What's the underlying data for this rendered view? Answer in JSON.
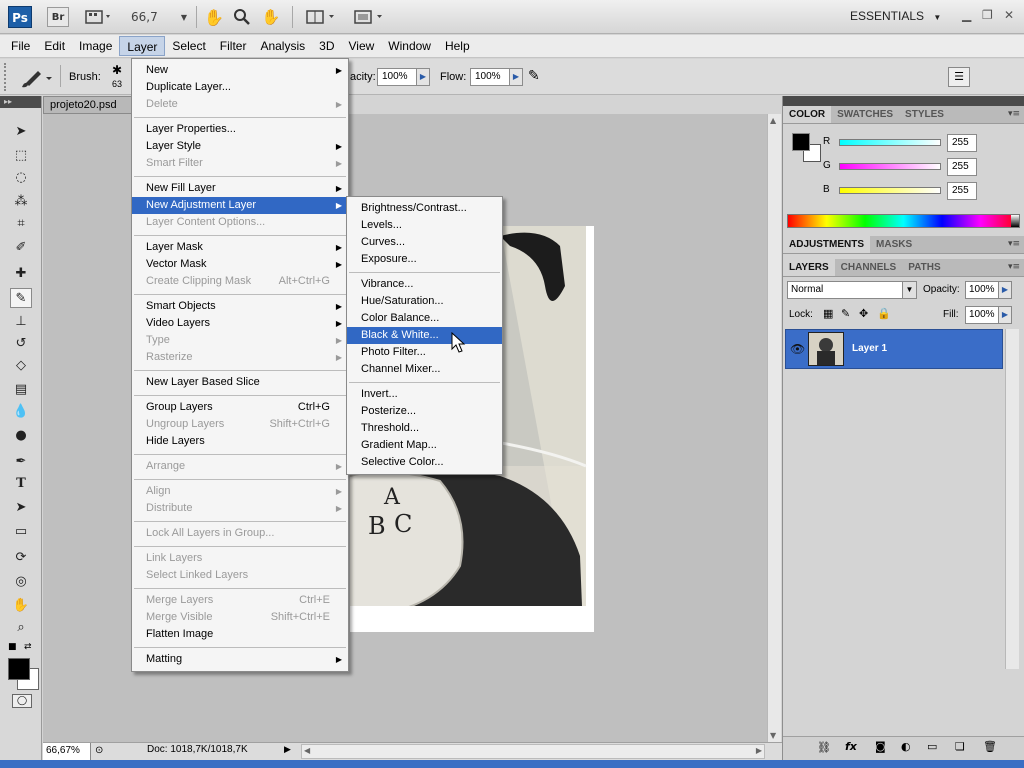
{
  "app": {
    "logo": "Ps",
    "bridge": "Br",
    "zoom": "66,7",
    "workspace": "ESSENTIALS"
  },
  "menubar": [
    "File",
    "Edit",
    "Image",
    "Layer",
    "Select",
    "Filter",
    "Analysis",
    "3D",
    "View",
    "Window",
    "Help"
  ],
  "options": {
    "brush_label": "Brush:",
    "brush_size": "63",
    "opacity_label": "acity:",
    "opacity_value": "100%",
    "flow_label": "Flow:",
    "flow_value": "100%"
  },
  "document": {
    "tab": "projeto20.psd",
    "photo_letters": [
      "A",
      "B",
      "C"
    ]
  },
  "status": {
    "zoom": "66,67%",
    "doc": "Doc: 1018,7K/1018,7K"
  },
  "layer_menu": [
    {
      "label": "New",
      "sub": true
    },
    {
      "label": "Duplicate Layer..."
    },
    {
      "label": "Delete",
      "disabled": true,
      "sub": true
    },
    {
      "sep": true
    },
    {
      "label": "Layer Properties..."
    },
    {
      "label": "Layer Style",
      "sub": true
    },
    {
      "label": "Smart Filter",
      "disabled": true,
      "sub": true
    },
    {
      "sep": true
    },
    {
      "label": "New Fill Layer",
      "sub": true
    },
    {
      "label": "New Adjustment Layer",
      "sub": true,
      "highlight": true
    },
    {
      "label": "Layer Content Options...",
      "disabled": true
    },
    {
      "sep": true
    },
    {
      "label": "Layer Mask",
      "sub": true
    },
    {
      "label": "Vector Mask",
      "sub": true
    },
    {
      "label": "Create Clipping Mask",
      "disabled": true,
      "shortcut": "Alt+Ctrl+G"
    },
    {
      "sep": true
    },
    {
      "label": "Smart Objects",
      "sub": true
    },
    {
      "label": "Video Layers",
      "sub": true
    },
    {
      "label": "Type",
      "disabled": true,
      "sub": true
    },
    {
      "label": "Rasterize",
      "disabled": true,
      "sub": true
    },
    {
      "sep": true
    },
    {
      "label": "New Layer Based Slice"
    },
    {
      "sep": true
    },
    {
      "label": "Group Layers",
      "shortcut": "Ctrl+G"
    },
    {
      "label": "Ungroup Layers",
      "disabled": true,
      "shortcut": "Shift+Ctrl+G"
    },
    {
      "label": "Hide Layers"
    },
    {
      "sep": true
    },
    {
      "label": "Arrange",
      "disabled": true,
      "sub": true
    },
    {
      "sep": true
    },
    {
      "label": "Align",
      "disabled": true,
      "sub": true
    },
    {
      "label": "Distribute",
      "disabled": true,
      "sub": true
    },
    {
      "sep": true
    },
    {
      "label": "Lock All Layers in Group...",
      "disabled": true
    },
    {
      "sep": true
    },
    {
      "label": "Link Layers",
      "disabled": true
    },
    {
      "label": "Select Linked Layers",
      "disabled": true
    },
    {
      "sep": true
    },
    {
      "label": "Merge Layers",
      "disabled": true,
      "shortcut": "Ctrl+E"
    },
    {
      "label": "Merge Visible",
      "disabled": true,
      "shortcut": "Shift+Ctrl+E"
    },
    {
      "label": "Flatten Image"
    },
    {
      "sep": true
    },
    {
      "label": "Matting",
      "sub": true
    }
  ],
  "adjustment_menu": [
    {
      "label": "Brightness/Contrast..."
    },
    {
      "label": "Levels..."
    },
    {
      "label": "Curves..."
    },
    {
      "label": "Exposure..."
    },
    {
      "sep": true
    },
    {
      "label": "Vibrance..."
    },
    {
      "label": "Hue/Saturation..."
    },
    {
      "label": "Color Balance..."
    },
    {
      "label": "Black & White...",
      "highlight": true
    },
    {
      "label": "Photo Filter..."
    },
    {
      "label": "Channel Mixer..."
    },
    {
      "sep": true
    },
    {
      "label": "Invert..."
    },
    {
      "label": "Posterize..."
    },
    {
      "label": "Threshold..."
    },
    {
      "label": "Gradient Map..."
    },
    {
      "label": "Selective Color..."
    }
  ],
  "color_panel": {
    "tabs": [
      "COLOR",
      "SWATCHES",
      "STYLES"
    ],
    "channels": [
      {
        "name": "R",
        "value": "255",
        "color": "#00e5e5"
      },
      {
        "name": "G",
        "value": "255",
        "color": "#e500e5"
      },
      {
        "name": "B",
        "value": "255",
        "color": "#e5e500"
      }
    ]
  },
  "adjust_panel": {
    "tabs": [
      "ADJUSTMENTS",
      "MASKS"
    ]
  },
  "layers_panel": {
    "tabs": [
      "LAYERS",
      "CHANNELS",
      "PATHS"
    ],
    "blend_mode": "Normal",
    "opacity_label": "Opacity:",
    "opacity": "100%",
    "lock_label": "Lock:",
    "fill_label": "Fill:",
    "fill": "100%",
    "layers": [
      {
        "name": "Layer 1"
      }
    ]
  },
  "colors": {
    "accent": "#3168c4",
    "selected_layer": "#3a6dc8"
  }
}
